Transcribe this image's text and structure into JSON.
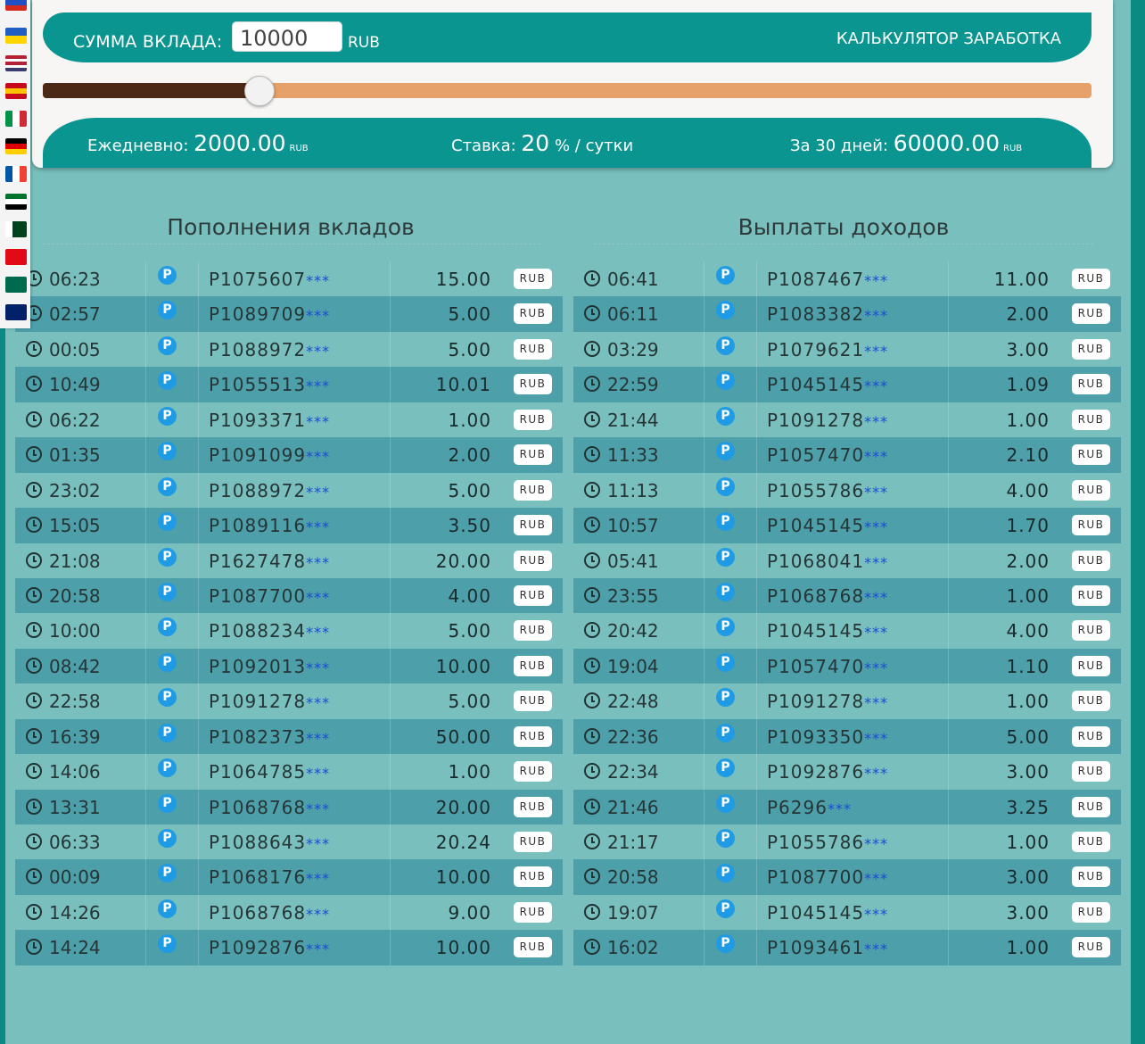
{
  "flags": [
    {
      "name": "russia-flag-icon",
      "stripes": [
        "#ffffff",
        "#1f50c4",
        "#d52b1e"
      ]
    },
    {
      "name": "ukraine-flag-icon",
      "stripes": [
        "#1f5fc4",
        "#ffd500"
      ]
    },
    {
      "name": "usa-flag-icon",
      "stripes": [
        "#b22234",
        "#ffffff",
        "#b22234",
        "#ffffff",
        "#3c3b6e"
      ]
    },
    {
      "name": "spain-flag-icon",
      "stripes": [
        "#c60b1e",
        "#ffc400",
        "#c60b1e"
      ]
    },
    {
      "name": "italy-flag-icon",
      "vstripes": [
        "#009246",
        "#ffffff",
        "#ce2b37"
      ]
    },
    {
      "name": "germany-flag-icon",
      "stripes": [
        "#000000",
        "#dd0000",
        "#ffce00"
      ]
    },
    {
      "name": "france-flag-icon",
      "vstripes": [
        "#0055a4",
        "#ffffff",
        "#ef4135"
      ]
    },
    {
      "name": "uae-flag-icon",
      "stripes": [
        "#00732f",
        "#ffffff",
        "#000000"
      ]
    },
    {
      "name": "pakistan-flag-icon",
      "vstripes": [
        "#ffffff",
        "#01411c",
        "#01411c"
      ]
    },
    {
      "name": "turkey-flag-icon",
      "stripes": [
        "#e30a17"
      ]
    },
    {
      "name": "bangladesh-flag-icon",
      "stripes": [
        "#006a4e"
      ]
    },
    {
      "name": "new-zealand-flag-icon",
      "stripes": [
        "#012169"
      ]
    }
  ],
  "calculator": {
    "amount_label": "СУММА ВКЛАДА:",
    "amount_value": "10000",
    "amount_currency": "RUB",
    "title": "КАЛЬКУЛЯТОР ЗАРАБОТКА",
    "slider_fraction": 0.206,
    "daily_label": "Ежедневно:",
    "daily_value": "2000.00",
    "daily_unit": "RUB",
    "rate_label": "Ставка:",
    "rate_value": "20",
    "rate_unit": "% / сутки",
    "month_label": "За 30 дней:",
    "month_value": "60000.00",
    "month_unit": "RUB"
  },
  "deposits": {
    "title": "Пополнения вкладов",
    "currency": "RUB",
    "rows": [
      {
        "time": "06:23",
        "account": "P1075607",
        "amount": "15.00"
      },
      {
        "time": "02:57",
        "account": "P1089709",
        "amount": "5.00"
      },
      {
        "time": "00:05",
        "account": "P1088972",
        "amount": "5.00"
      },
      {
        "time": "10:49",
        "account": "P1055513",
        "amount": "10.01"
      },
      {
        "time": "06:22",
        "account": "P1093371",
        "amount": "1.00"
      },
      {
        "time": "01:35",
        "account": "P1091099",
        "amount": "2.00"
      },
      {
        "time": "23:02",
        "account": "P1088972",
        "amount": "5.00"
      },
      {
        "time": "15:05",
        "account": "P1089116",
        "amount": "3.50"
      },
      {
        "time": "21:08",
        "account": "P1627478",
        "amount": "20.00"
      },
      {
        "time": "20:58",
        "account": "P1087700",
        "amount": "4.00"
      },
      {
        "time": "10:00",
        "account": "P1088234",
        "amount": "5.00"
      },
      {
        "time": "08:42",
        "account": "P1092013",
        "amount": "10.00"
      },
      {
        "time": "22:58",
        "account": "P1091278",
        "amount": "5.00"
      },
      {
        "time": "16:39",
        "account": "P1082373",
        "amount": "50.00"
      },
      {
        "time": "14:06",
        "account": "P1064785",
        "amount": "1.00"
      },
      {
        "time": "13:31",
        "account": "P1068768",
        "amount": "20.00"
      },
      {
        "time": "06:33",
        "account": "P1088643",
        "amount": "20.24"
      },
      {
        "time": "00:09",
        "account": "P1068176",
        "amount": "10.00"
      },
      {
        "time": "14:26",
        "account": "P1068768",
        "amount": "9.00"
      },
      {
        "time": "14:24",
        "account": "P1092876",
        "amount": "10.00"
      }
    ]
  },
  "payouts": {
    "title": "Выплаты доходов",
    "currency": "RUB",
    "rows": [
      {
        "time": "06:41",
        "account": "P1087467",
        "amount": "11.00"
      },
      {
        "time": "06:11",
        "account": "P1083382",
        "amount": "2.00"
      },
      {
        "time": "03:29",
        "account": "P1079621",
        "amount": "3.00"
      },
      {
        "time": "22:59",
        "account": "P1045145",
        "amount": "1.09"
      },
      {
        "time": "21:44",
        "account": "P1091278",
        "amount": "1.00"
      },
      {
        "time": "11:33",
        "account": "P1057470",
        "amount": "2.10"
      },
      {
        "time": "11:13",
        "account": "P1055786",
        "amount": "4.00"
      },
      {
        "time": "10:57",
        "account": "P1045145",
        "amount": "1.70"
      },
      {
        "time": "05:41",
        "account": "P1068041",
        "amount": "2.00"
      },
      {
        "time": "23:55",
        "account": "P1068768",
        "amount": "1.00"
      },
      {
        "time": "20:42",
        "account": "P1045145",
        "amount": "4.00"
      },
      {
        "time": "19:04",
        "account": "P1057470",
        "amount": "1.10"
      },
      {
        "time": "22:48",
        "account": "P1091278",
        "amount": "1.00"
      },
      {
        "time": "22:36",
        "account": "P1093350",
        "amount": "5.00"
      },
      {
        "time": "22:34",
        "account": "P1092876",
        "amount": "3.00"
      },
      {
        "time": "21:46",
        "account": "P6296",
        "amount": "3.25"
      },
      {
        "time": "21:17",
        "account": "P1055786",
        "amount": "1.00"
      },
      {
        "time": "20:58",
        "account": "P1087700",
        "amount": "3.00"
      },
      {
        "time": "19:07",
        "account": "P1045145",
        "amount": "3.00"
      },
      {
        "time": "16:02",
        "account": "P1093461",
        "amount": "1.00"
      }
    ]
  },
  "common": {
    "masked_suffix": "***",
    "payment_icon_letter": "P"
  }
}
